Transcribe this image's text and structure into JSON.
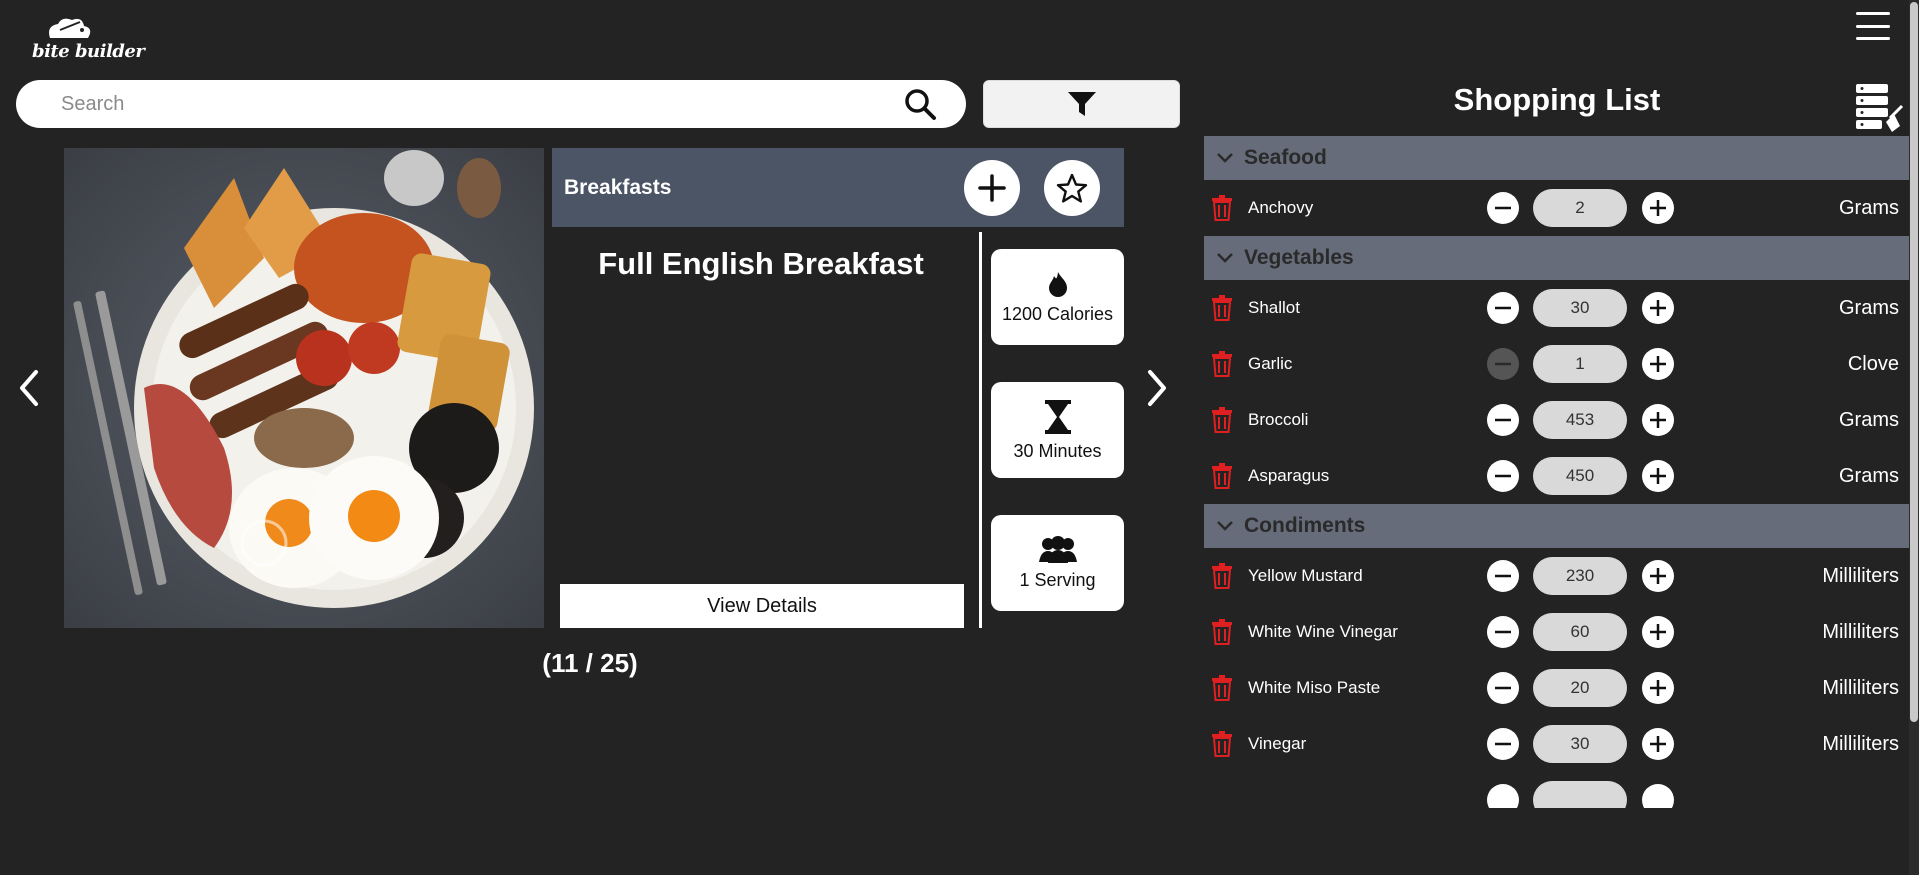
{
  "app": {
    "logo_text": "bite builder"
  },
  "search": {
    "placeholder": "Search",
    "value": ""
  },
  "carousel": {
    "category": "Breakfasts",
    "title": "Full English Breakfast",
    "view_details": "View Details",
    "stats": [
      {
        "icon": "flame-icon",
        "label": "1200 Calories"
      },
      {
        "icon": "hourglass-icon",
        "label": "30 Minutes"
      },
      {
        "icon": "people-icon",
        "label": "1 Serving"
      }
    ],
    "counter": "(11 / 25)"
  },
  "shopping_list": {
    "title": "Shopping List",
    "categories": [
      {
        "name": "Seafood",
        "items": [
          {
            "name": "Anchovy",
            "qty": "2",
            "unit": "Grams",
            "minus_disabled": false
          }
        ]
      },
      {
        "name": "Vegetables",
        "items": [
          {
            "name": "Shallot",
            "qty": "30",
            "unit": "Grams",
            "minus_disabled": false
          },
          {
            "name": "Garlic",
            "qty": "1",
            "unit": "Clove",
            "minus_disabled": true
          },
          {
            "name": "Broccoli",
            "qty": "453",
            "unit": "Grams",
            "minus_disabled": false
          },
          {
            "name": "Asparagus",
            "qty": "450",
            "unit": "Grams",
            "minus_disabled": false
          }
        ]
      },
      {
        "name": "Condiments",
        "items": [
          {
            "name": "Yellow Mustard",
            "qty": "230",
            "unit": "Milliliters",
            "minus_disabled": false
          },
          {
            "name": "White Wine Vinegar",
            "qty": "60",
            "unit": "Milliliters",
            "minus_disabled": false
          },
          {
            "name": "White Miso Paste",
            "qty": "20",
            "unit": "Milliliters",
            "minus_disabled": false
          },
          {
            "name": "Vinegar",
            "qty": "30",
            "unit": "Milliliters",
            "minus_disabled": false
          },
          {
            "name": "",
            "qty": "",
            "unit": "",
            "minus_disabled": false
          }
        ]
      }
    ]
  },
  "colors": {
    "background": "#232323",
    "card_header": "#4c5566",
    "category_header": "#666c7a",
    "trash": "#e02020"
  }
}
